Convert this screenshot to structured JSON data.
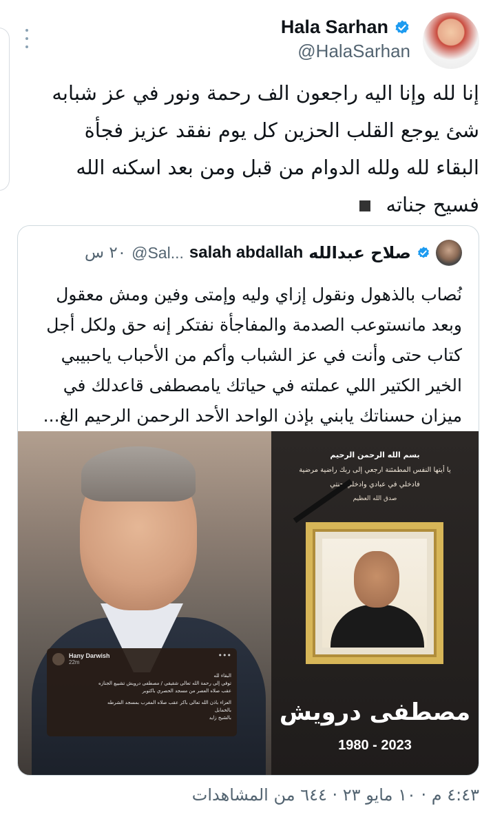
{
  "author": {
    "name": "Hala Sarhan",
    "handle": "@HalaSarhan"
  },
  "tweet": {
    "lines": [
      "إنا لله وإنا اليه راجعون الف رحمة ونور في عز شبابه",
      "شئ يوجع القلب الحزين كل يوم نفقد عزيز فجأة",
      "البقاء لله ولله الدوام من قبل ومن بعد  اسكنه الله",
      "فسيح جناته"
    ]
  },
  "quote": {
    "name_ar": "صلاح عبدالله",
    "name_en": "salah abdallah",
    "handle": "@Sal...",
    "time": "٢٠ س",
    "lines": [
      "نُصاب بالذهول ونقول إزاي وليه وإمتى وفين ومش معقول",
      "وبعد مانستوعب الصدمة والمفاجأة نفتكر إنه حق ولكل أجل",
      "كتاب حتى وأنت في عز الشباب وأكم من الأحباب ياحبيبي",
      "الخير الكتير اللي عملته في حياتك يامصطفى قاعدلك في",
      "ميزان حسناتك يابني بإذن الواحد الأحد الرحمن الرحيم الغ..."
    ],
    "media": {
      "fb_post": {
        "name": "Hany Darwish",
        "time": "22m",
        "lines": [
          "البقاء لله",
          "توفي إلى رحمة الله تعالى شقيقي / مصطفى درويش تشييع الجنازه",
          "عقب صلاه العصر من مسجد الحصري باكتوبر",
          "العزاء باذن الله تعالى باكر عقب صلاه المغرب بمسجد الشرطه",
          "بالخمايل",
          "بالشيخ زايد"
        ]
      },
      "poster": {
        "basmala": "بسم الله الرحمن الرحيم",
        "verse1": "يا أيتها النفس المطمئنة ارجعي إلى ربك راضية مرضية",
        "verse2": "فادخلي في عبادي وادخلي جنتي",
        "sadaq": "صدق الله العظيم",
        "name": "مصطفى درويش",
        "years": "1980 - 2023"
      }
    }
  },
  "meta": {
    "text": "٤:٤٣ م · ١٠ مايو ٢٣ · ٦٤٤ من المشاهدات"
  },
  "colors": {
    "verified": "#1d9bf0",
    "secondary_text": "#536471",
    "border": "#cfd9de"
  },
  "icons": [
    "verified-badge-icon",
    "more-icon",
    "black-square-emoji"
  ]
}
